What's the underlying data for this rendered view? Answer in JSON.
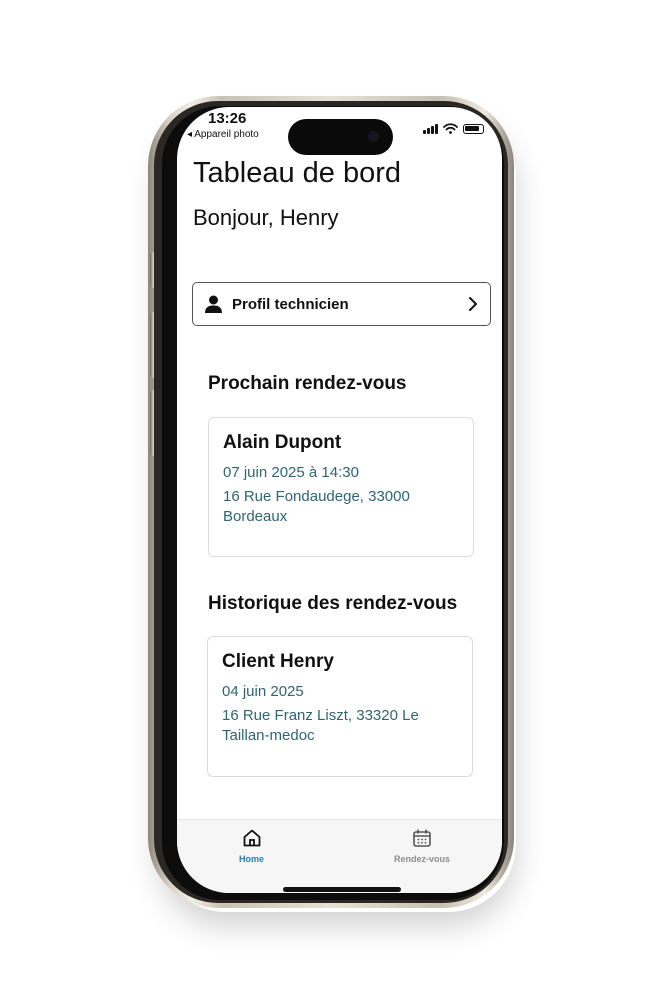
{
  "status_bar": {
    "time": "13:26",
    "back_app": "◂ Appareil photo"
  },
  "header": {
    "title": "Tableau de bord",
    "greeting": "Bonjour, Henry"
  },
  "profile_button": {
    "label": "Profil technicien",
    "icon": "person-icon",
    "chevron": "chevron-right-icon"
  },
  "next_appointment": {
    "section_title": "Prochain rendez-vous",
    "client": "Alain Dupont",
    "datetime": "07 juin 2025 à 14:30",
    "address": "16 Rue Fondaudege, 33000 Bordeaux"
  },
  "history": {
    "section_title": "Historique des rendez-vous",
    "items": [
      {
        "client": "Client Henry",
        "date": "04 juin 2025",
        "address": "16 Rue Franz Liszt, 33320 Le Taillan-medoc"
      }
    ]
  },
  "tabbar": {
    "items": [
      {
        "label": "Home",
        "icon": "home-icon",
        "active": true
      },
      {
        "label": "Rendez-vous",
        "icon": "calendar-icon",
        "active": false
      }
    ]
  },
  "colors": {
    "accent": "#2a7fb0",
    "muted": "#8e8e8e",
    "address_text": "#2f6571",
    "frame": "#d9d2c6"
  }
}
